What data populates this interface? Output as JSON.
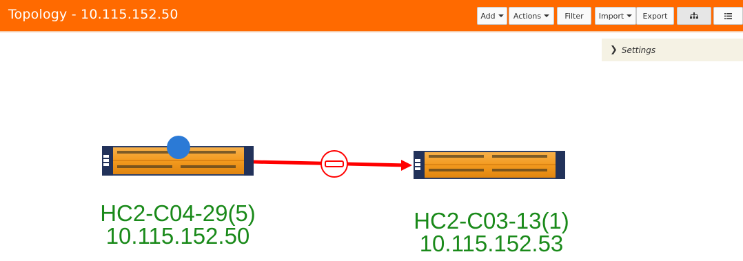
{
  "header": {
    "title": "Topology - 10.115.152.50",
    "buttons": {
      "add": "Add",
      "actions": "Actions",
      "filter": "Filter",
      "import": "Import",
      "export": "Export"
    },
    "color": "#ff6a00"
  },
  "settings_panel": {
    "label": "Settings"
  },
  "nodes": [
    {
      "name": "HC2-C04-29(5)",
      "ip": "10.115.152.50"
    },
    {
      "name": "HC2-C03-13(1)",
      "ip": "10.115.152.53"
    }
  ],
  "link": {
    "color": "#ff0000"
  },
  "icons": [
    "tree-view-icon",
    "list-view-icon",
    "chevron-right-icon",
    "device-icon",
    "status-dot-icon",
    "filter-map-icon"
  ],
  "colors": {
    "label": "#1a8a1a",
    "device": "#f39a1e",
    "dot": "#2b7ad6"
  }
}
